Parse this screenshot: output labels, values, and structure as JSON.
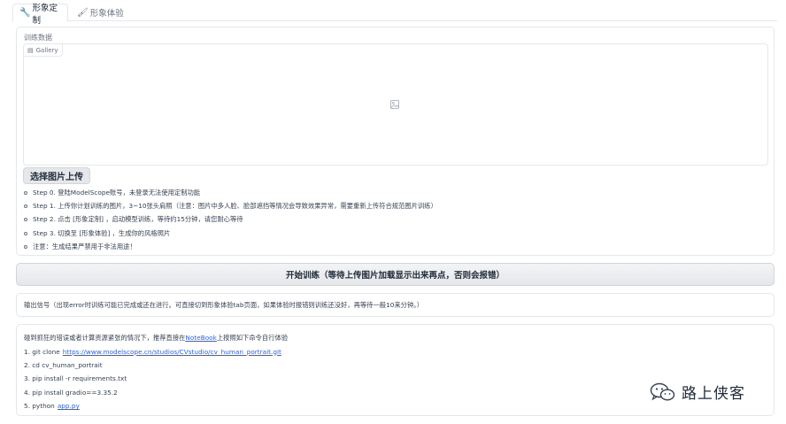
{
  "tabs": [
    {
      "label": "形象定制",
      "icon": "tool-icon",
      "active": true
    },
    {
      "label": "形象体验",
      "icon": "brush-icon",
      "active": false
    }
  ],
  "train_panel": {
    "block_label": "训练数据",
    "gallery_tag": "Gallery",
    "upload_button": "选择图片上传",
    "steps": [
      "Step 0. 登陆ModelScope账号，未登录无法使用定制功能",
      "Step 1. 上传你计划训练的图片，3~10张头肩照（注意：图片中多人脸、脸部遮挡等情况会导致效果异常，需要重新上传符合规范图片训练）",
      "Step 2. 点击 [形象定制] ，启动模型训练，等待约15分钟，请您耐心等待",
      "Step 3. 切换至 [形象体验] ，生成你的风格照片",
      "注意：生成结果严禁用于非法用途！"
    ]
  },
  "train_button": "开始训练（等待上传图片加载显示出来再点，否则会报错）",
  "output_text": "输出信号（出现error时训练可能已完成或还在进行。可直接切到形象体验tab页面，如果体验时报错则训练还没好，再等待一般10来分钟。）",
  "notes": {
    "intro_before": "碰到抓狂的错误或者计算资源紧张的情况下，推荐直接在",
    "intro_link": "NoteBook",
    "intro_after": "上按照如下命令自行体验",
    "line1_prefix": "1. git clone",
    "line1_link": "https://www.modelscope.cn/studios/CVstudio/cv_human_portrait.git",
    "line2": "2. cd cv_human_portrait",
    "line3": "3. pip install -r requirements.txt",
    "line4": "4. pip install gradio==3.35.2",
    "line5_prefix": "5. python",
    "line5_link": "app.py"
  },
  "watermark": {
    "text": "路上侠客",
    "icon": "wechat-icon"
  },
  "colors": {
    "link": "#2563eb",
    "border": "#e5e7eb",
    "button_bg": "#e5e7eb"
  }
}
